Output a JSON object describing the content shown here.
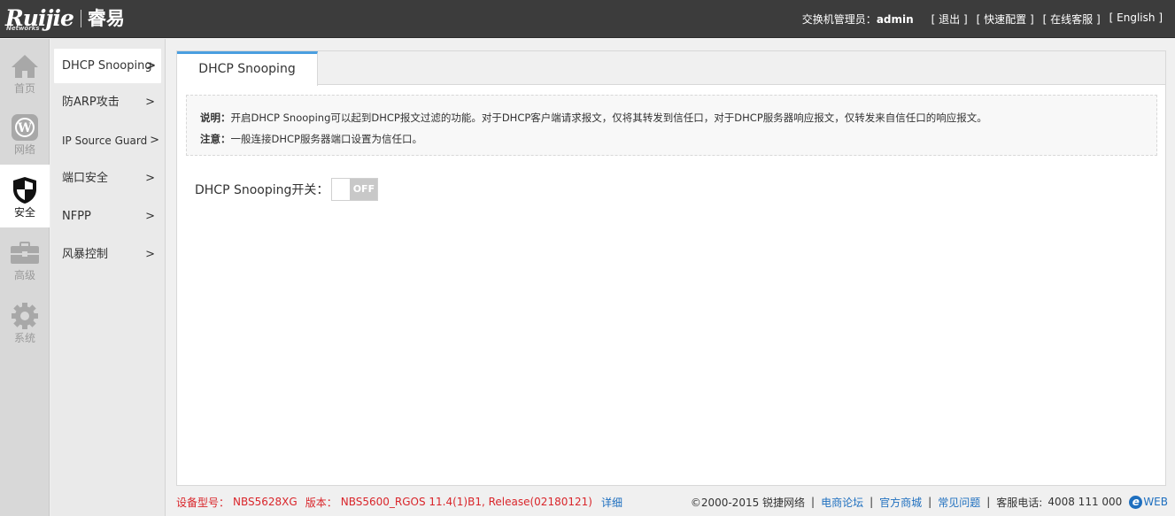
{
  "header": {
    "logo_text": "Ruijie",
    "logo_sub": "Networks",
    "logo_cn": "睿易",
    "user_label": "交换机管理员：",
    "user_name": "admin",
    "links": [
      "[ 退出 ]",
      "[ 快速配置 ]",
      "[ 在线客服 ]",
      "[ English ]"
    ]
  },
  "iconbar": {
    "items": [
      {
        "label": "首页",
        "icon": "home-icon"
      },
      {
        "label": "网络",
        "icon": "network-icon"
      },
      {
        "label": "安全",
        "icon": "shield-icon"
      },
      {
        "label": "高级",
        "icon": "toolbox-icon"
      },
      {
        "label": "系统",
        "icon": "gear-icon"
      }
    ],
    "active_index": 2
  },
  "submenu": {
    "items": [
      {
        "label": "DHCP Snooping",
        "arrow": ">"
      },
      {
        "label": "防ARP攻击",
        "arrow": ">"
      },
      {
        "label": "IP Source Guard",
        "arrow": ">"
      },
      {
        "label": "端口安全",
        "arrow": ">"
      },
      {
        "label": "NFPP",
        "arrow": ">"
      },
      {
        "label": "风暴控制",
        "arrow": ">"
      }
    ],
    "active_index": 0
  },
  "main": {
    "tab_label": "DHCP Snooping",
    "notice": {
      "desc_label": "说明：",
      "desc_text": "开启DHCP Snooping可以起到DHCP报文过滤的功能。对于DHCP客户端请求报文，仅将其转发到信任口，对于DHCP服务器响应报文，仅转发来自信任口的响应报文。",
      "note_label": "注意：",
      "note_text": "一般连接DHCP服务器端口设置为信任口。"
    },
    "switch_label": "DHCP Snooping开关：",
    "switch_state": "OFF"
  },
  "footer": {
    "model_label": "设备型号：",
    "model": "NBS5628XG",
    "version_label": "版本：",
    "version": "NBS5600_RGOS 11.4(1)B1, Release(02180121)",
    "detail_link": "详细",
    "copyright": "©2000-2015 锐捷网络",
    "links": [
      "电商论坛",
      "官方商城",
      "常见问题"
    ],
    "hotline_label": "客服电话:",
    "hotline": "4008 111 000",
    "eweb": "WEB"
  }
}
